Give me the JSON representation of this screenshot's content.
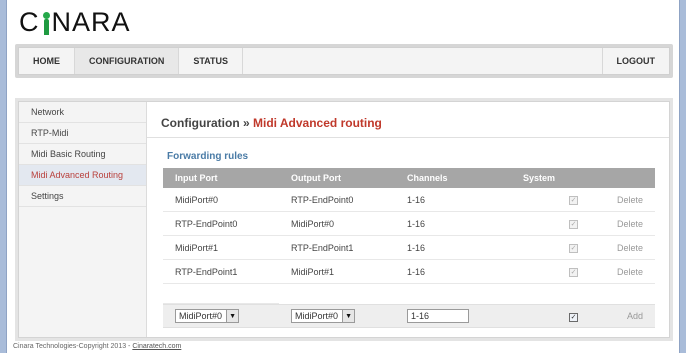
{
  "logo": {
    "text_before": "C",
    "text_after": "NARA"
  },
  "nav": {
    "items": [
      "HOME",
      "CONFIGURATION",
      "STATUS"
    ],
    "logout": "LOGOUT"
  },
  "sidebar": {
    "items": [
      "Network",
      "RTP-Midi",
      "Midi Basic Routing",
      "Midi Advanced Routing",
      "Settings"
    ]
  },
  "main": {
    "title": "Configuration",
    "separator": " » ",
    "subtitle": "Midi Advanced routing",
    "section_title": "Forwarding rules"
  },
  "table": {
    "headers": [
      "Input Port",
      "Output Port",
      "Channels",
      "System"
    ],
    "rows": [
      {
        "input": "MidiPort#0",
        "output": "RTP-EndPoint0",
        "channels": "1-16",
        "system": true,
        "action": "Delete"
      },
      {
        "input": "RTP-EndPoint0",
        "output": "MidiPort#0",
        "channels": "1-16",
        "system": true,
        "action": "Delete"
      },
      {
        "input": "MidiPort#1",
        "output": "RTP-EndPoint1",
        "channels": "1-16",
        "system": true,
        "action": "Delete"
      },
      {
        "input": "RTP-EndPoint1",
        "output": "MidiPort#1",
        "channels": "1-16",
        "system": true,
        "action": "Delete"
      }
    ],
    "add_row": {
      "input_selected": "MidiPort#0",
      "output_selected": "MidiPort#0",
      "channels_value": "1-16",
      "system": true,
      "action": "Add"
    }
  },
  "footer": {
    "text": "Cinara Technologies-Copyright 2013 - ",
    "link": "Cinaratech.com"
  },
  "colors": {
    "accent_red": "#c0392b",
    "section_blue": "#4a7ba6",
    "logo_green": "#25a84a",
    "header_gray": "#a6a6a6"
  }
}
